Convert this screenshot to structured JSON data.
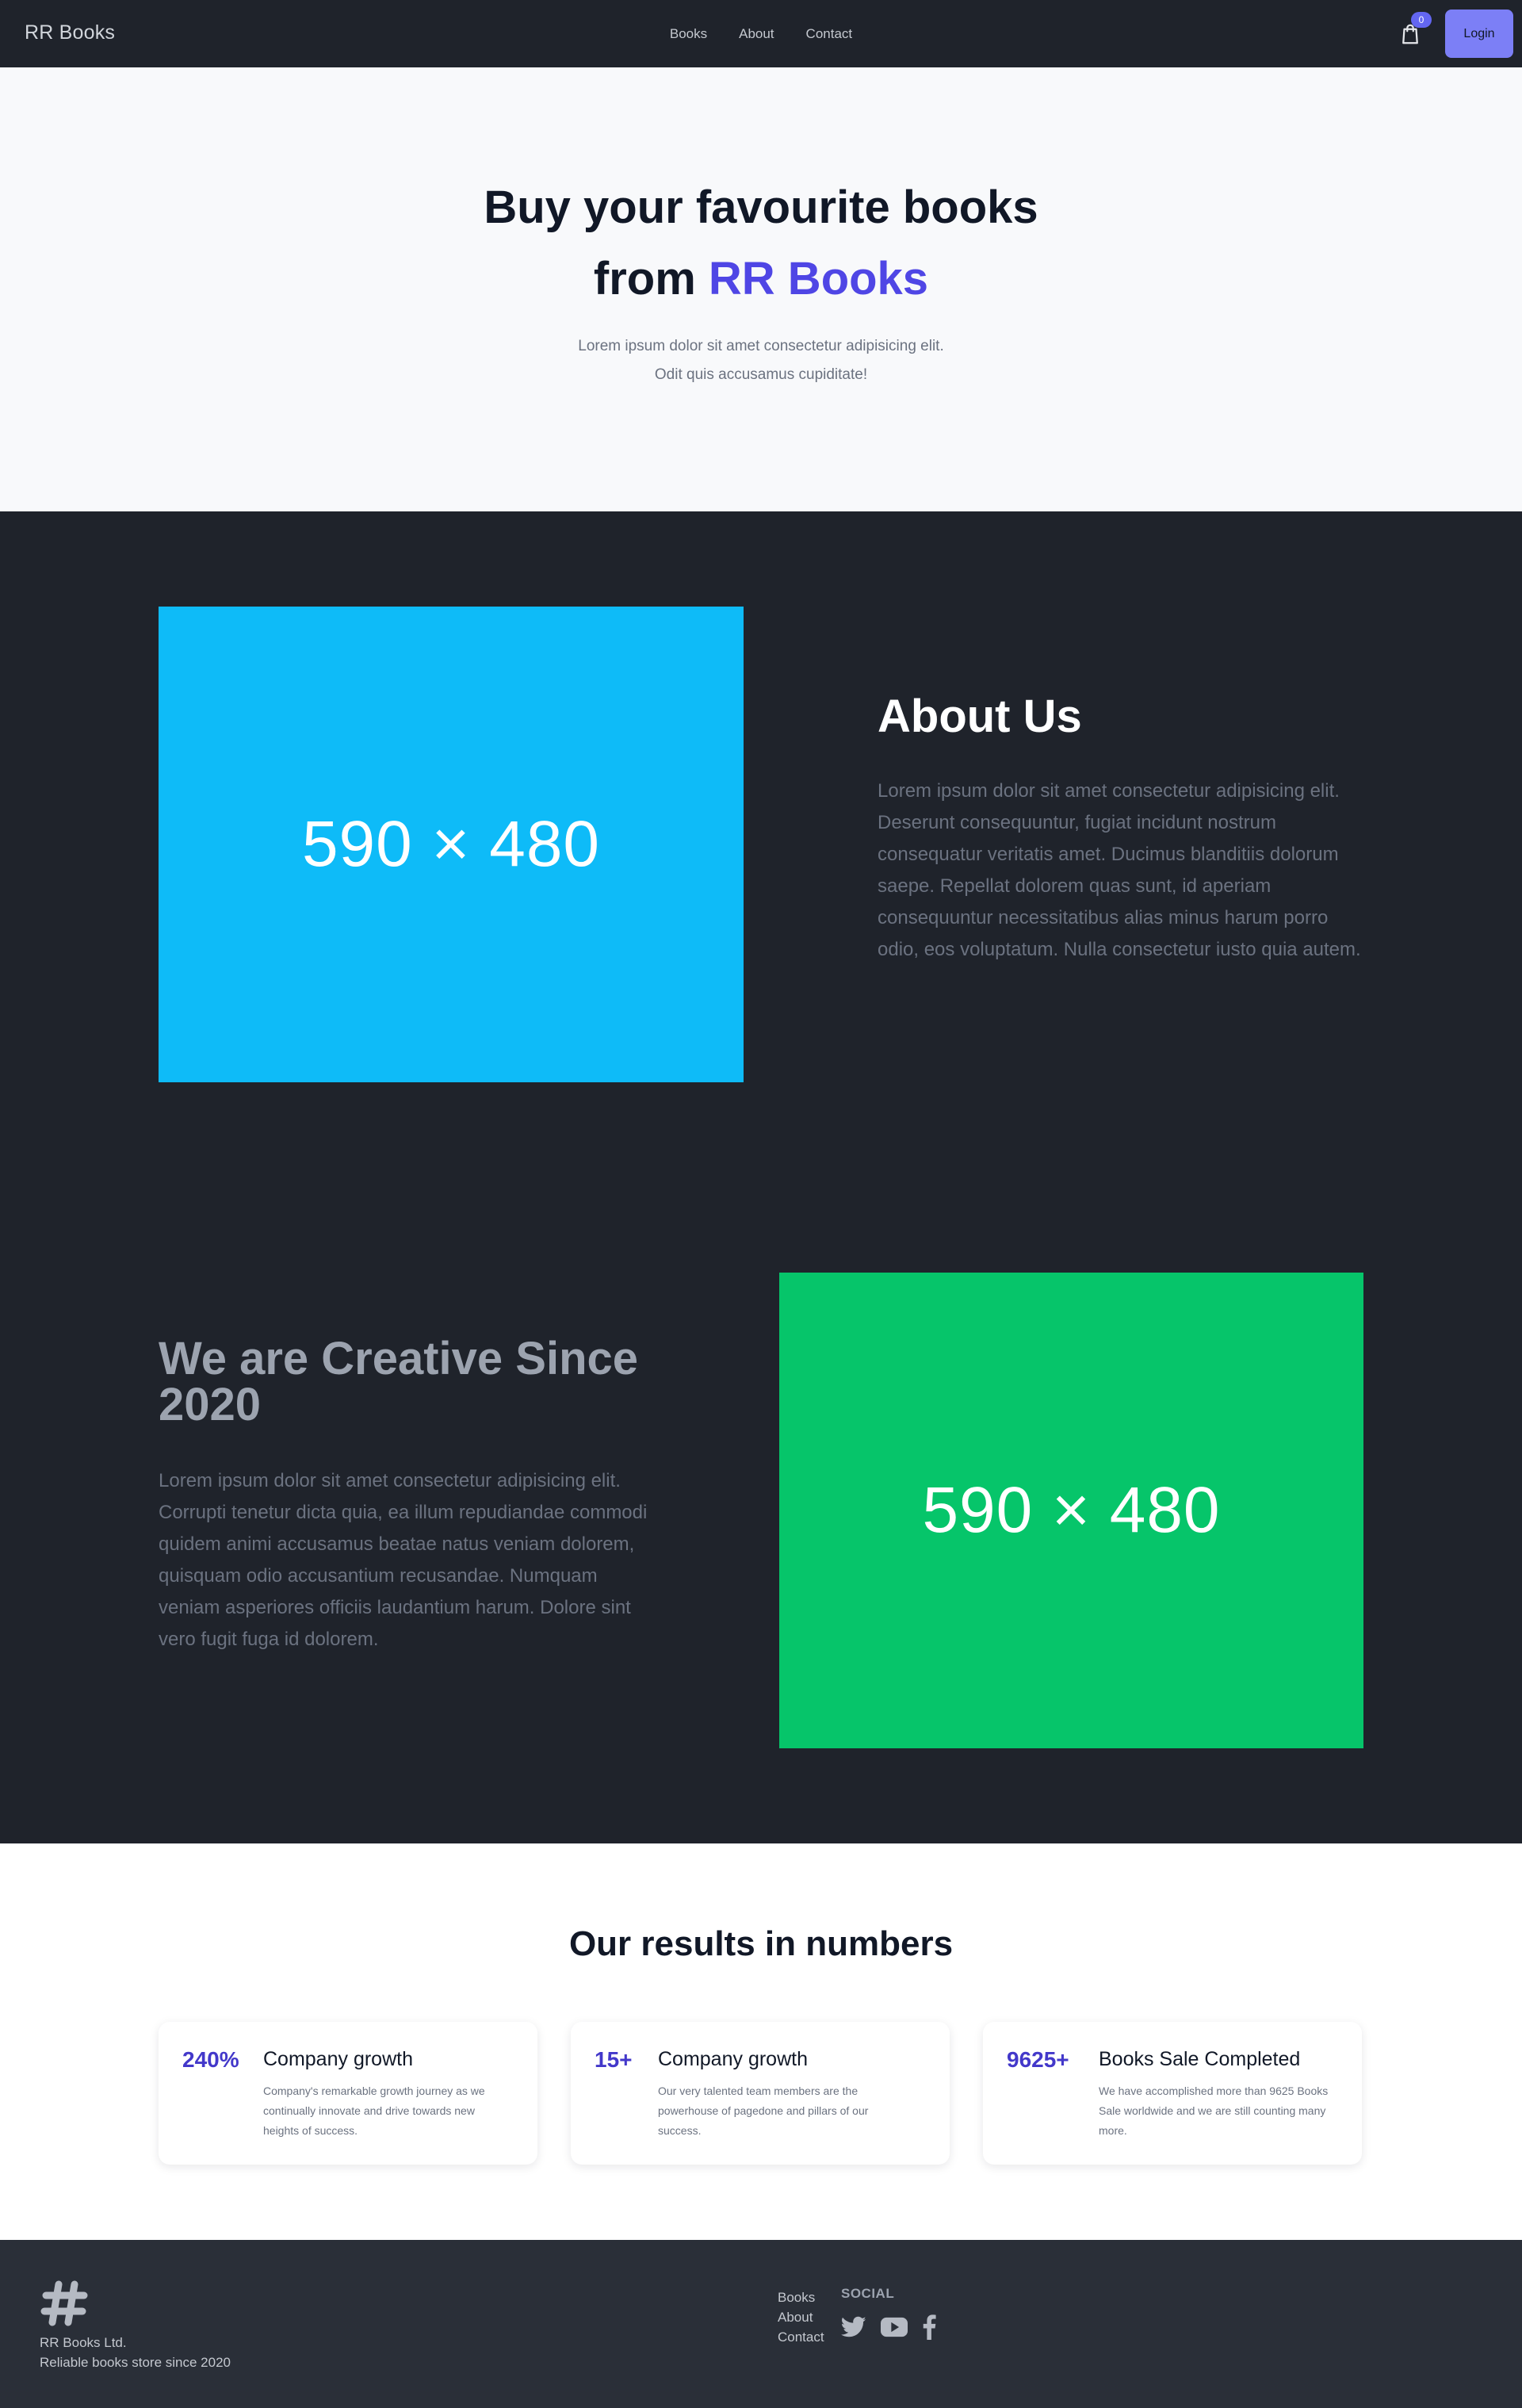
{
  "nav": {
    "brand": "RR Books",
    "links": [
      "Books",
      "About",
      "Contact"
    ],
    "cart_count": "0",
    "login_label": "Login"
  },
  "hero": {
    "title_line1": "Buy your favourite books",
    "title_line2_prefix": "from ",
    "title_line2_accent": "RR Books",
    "subtitle": "Lorem ipsum dolor sit amet consectetur adipisicing elit. Odit quis accusamus cupiditate!"
  },
  "about": {
    "image_label": "590 × 480",
    "title": "About Us",
    "text": "Lorem ipsum dolor sit amet consectetur adipisicing elit. Deserunt consequuntur, fugiat incidunt nostrum consequatur veritatis amet. Ducimus blanditiis dolorum saepe. Repellat dolorem quas sunt, id aperiam consequuntur necessitatibus alias minus harum porro odio, eos voluptatum. Nulla consectetur iusto quia autem."
  },
  "creative": {
    "title": "We are Creative Since 2020",
    "text": "Lorem ipsum dolor sit amet consectetur adipisicing elit. Corrupti tenetur dicta quia, ea illum repudiandae commodi quidem animi accusamus beatae natus veniam dolorem, quisquam odio accusantium recusandae. Numquam veniam asperiores officiis laudantium harum. Dolore sint vero fugit fuga id dolorem.",
    "image_label": "590 × 480"
  },
  "results": {
    "title": "Our results in numbers",
    "stats": [
      {
        "number": "240%",
        "heading": "Company growth",
        "description": "Company's remarkable growth journey as we continually innovate and drive towards new heights of success."
      },
      {
        "number": "15+",
        "heading": "Company growth",
        "description": "Our very talented team members are the powerhouse of pagedone and pillars of our success."
      },
      {
        "number": "9625+",
        "heading": "Books Sale Completed",
        "description": "We have accomplished more than 9625 Books Sale worldwide and we are still counting many more."
      }
    ]
  },
  "footer": {
    "company": "RR Books Ltd.",
    "tagline": "Reliable books store since 2020",
    "links": [
      "Books",
      "About",
      "Contact"
    ],
    "social_title": "SOCIAL",
    "social_icons": [
      "twitter-icon",
      "youtube-icon",
      "facebook-icon"
    ]
  },
  "colors": {
    "dark_bg": "#1f232b",
    "footer_bg": "#2a2f38",
    "accent": "#4f46e5",
    "login_bg": "#7c7ff6",
    "placeholder_blue": "#0ebbf8",
    "placeholder_green": "#06c56a"
  }
}
